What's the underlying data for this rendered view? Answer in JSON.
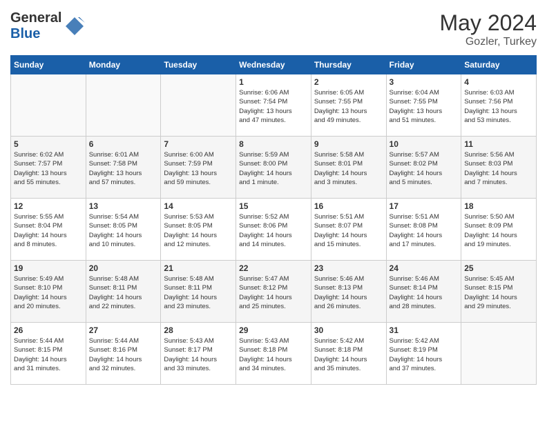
{
  "header": {
    "logo_general": "General",
    "logo_blue": "Blue",
    "month_year": "May 2024",
    "location": "Gozler, Turkey"
  },
  "weekdays": [
    "Sunday",
    "Monday",
    "Tuesday",
    "Wednesday",
    "Thursday",
    "Friday",
    "Saturday"
  ],
  "weeks": [
    {
      "days": [
        {
          "num": "",
          "info": ""
        },
        {
          "num": "",
          "info": ""
        },
        {
          "num": "",
          "info": ""
        },
        {
          "num": "1",
          "info": "Sunrise: 6:06 AM\nSunset: 7:54 PM\nDaylight: 13 hours\nand 47 minutes."
        },
        {
          "num": "2",
          "info": "Sunrise: 6:05 AM\nSunset: 7:55 PM\nDaylight: 13 hours\nand 49 minutes."
        },
        {
          "num": "3",
          "info": "Sunrise: 6:04 AM\nSunset: 7:55 PM\nDaylight: 13 hours\nand 51 minutes."
        },
        {
          "num": "4",
          "info": "Sunrise: 6:03 AM\nSunset: 7:56 PM\nDaylight: 13 hours\nand 53 minutes."
        }
      ]
    },
    {
      "days": [
        {
          "num": "5",
          "info": "Sunrise: 6:02 AM\nSunset: 7:57 PM\nDaylight: 13 hours\nand 55 minutes."
        },
        {
          "num": "6",
          "info": "Sunrise: 6:01 AM\nSunset: 7:58 PM\nDaylight: 13 hours\nand 57 minutes."
        },
        {
          "num": "7",
          "info": "Sunrise: 6:00 AM\nSunset: 7:59 PM\nDaylight: 13 hours\nand 59 minutes."
        },
        {
          "num": "8",
          "info": "Sunrise: 5:59 AM\nSunset: 8:00 PM\nDaylight: 14 hours\nand 1 minute."
        },
        {
          "num": "9",
          "info": "Sunrise: 5:58 AM\nSunset: 8:01 PM\nDaylight: 14 hours\nand 3 minutes."
        },
        {
          "num": "10",
          "info": "Sunrise: 5:57 AM\nSunset: 8:02 PM\nDaylight: 14 hours\nand 5 minutes."
        },
        {
          "num": "11",
          "info": "Sunrise: 5:56 AM\nSunset: 8:03 PM\nDaylight: 14 hours\nand 7 minutes."
        }
      ]
    },
    {
      "days": [
        {
          "num": "12",
          "info": "Sunrise: 5:55 AM\nSunset: 8:04 PM\nDaylight: 14 hours\nand 8 minutes."
        },
        {
          "num": "13",
          "info": "Sunrise: 5:54 AM\nSunset: 8:05 PM\nDaylight: 14 hours\nand 10 minutes."
        },
        {
          "num": "14",
          "info": "Sunrise: 5:53 AM\nSunset: 8:05 PM\nDaylight: 14 hours\nand 12 minutes."
        },
        {
          "num": "15",
          "info": "Sunrise: 5:52 AM\nSunset: 8:06 PM\nDaylight: 14 hours\nand 14 minutes."
        },
        {
          "num": "16",
          "info": "Sunrise: 5:51 AM\nSunset: 8:07 PM\nDaylight: 14 hours\nand 15 minutes."
        },
        {
          "num": "17",
          "info": "Sunrise: 5:51 AM\nSunset: 8:08 PM\nDaylight: 14 hours\nand 17 minutes."
        },
        {
          "num": "18",
          "info": "Sunrise: 5:50 AM\nSunset: 8:09 PM\nDaylight: 14 hours\nand 19 minutes."
        }
      ]
    },
    {
      "days": [
        {
          "num": "19",
          "info": "Sunrise: 5:49 AM\nSunset: 8:10 PM\nDaylight: 14 hours\nand 20 minutes."
        },
        {
          "num": "20",
          "info": "Sunrise: 5:48 AM\nSunset: 8:11 PM\nDaylight: 14 hours\nand 22 minutes."
        },
        {
          "num": "21",
          "info": "Sunrise: 5:48 AM\nSunset: 8:11 PM\nDaylight: 14 hours\nand 23 minutes."
        },
        {
          "num": "22",
          "info": "Sunrise: 5:47 AM\nSunset: 8:12 PM\nDaylight: 14 hours\nand 25 minutes."
        },
        {
          "num": "23",
          "info": "Sunrise: 5:46 AM\nSunset: 8:13 PM\nDaylight: 14 hours\nand 26 minutes."
        },
        {
          "num": "24",
          "info": "Sunrise: 5:46 AM\nSunset: 8:14 PM\nDaylight: 14 hours\nand 28 minutes."
        },
        {
          "num": "25",
          "info": "Sunrise: 5:45 AM\nSunset: 8:15 PM\nDaylight: 14 hours\nand 29 minutes."
        }
      ]
    },
    {
      "days": [
        {
          "num": "26",
          "info": "Sunrise: 5:44 AM\nSunset: 8:15 PM\nDaylight: 14 hours\nand 31 minutes."
        },
        {
          "num": "27",
          "info": "Sunrise: 5:44 AM\nSunset: 8:16 PM\nDaylight: 14 hours\nand 32 minutes."
        },
        {
          "num": "28",
          "info": "Sunrise: 5:43 AM\nSunset: 8:17 PM\nDaylight: 14 hours\nand 33 minutes."
        },
        {
          "num": "29",
          "info": "Sunrise: 5:43 AM\nSunset: 8:18 PM\nDaylight: 14 hours\nand 34 minutes."
        },
        {
          "num": "30",
          "info": "Sunrise: 5:42 AM\nSunset: 8:18 PM\nDaylight: 14 hours\nand 35 minutes."
        },
        {
          "num": "31",
          "info": "Sunrise: 5:42 AM\nSunset: 8:19 PM\nDaylight: 14 hours\nand 37 minutes."
        },
        {
          "num": "",
          "info": ""
        }
      ]
    }
  ]
}
